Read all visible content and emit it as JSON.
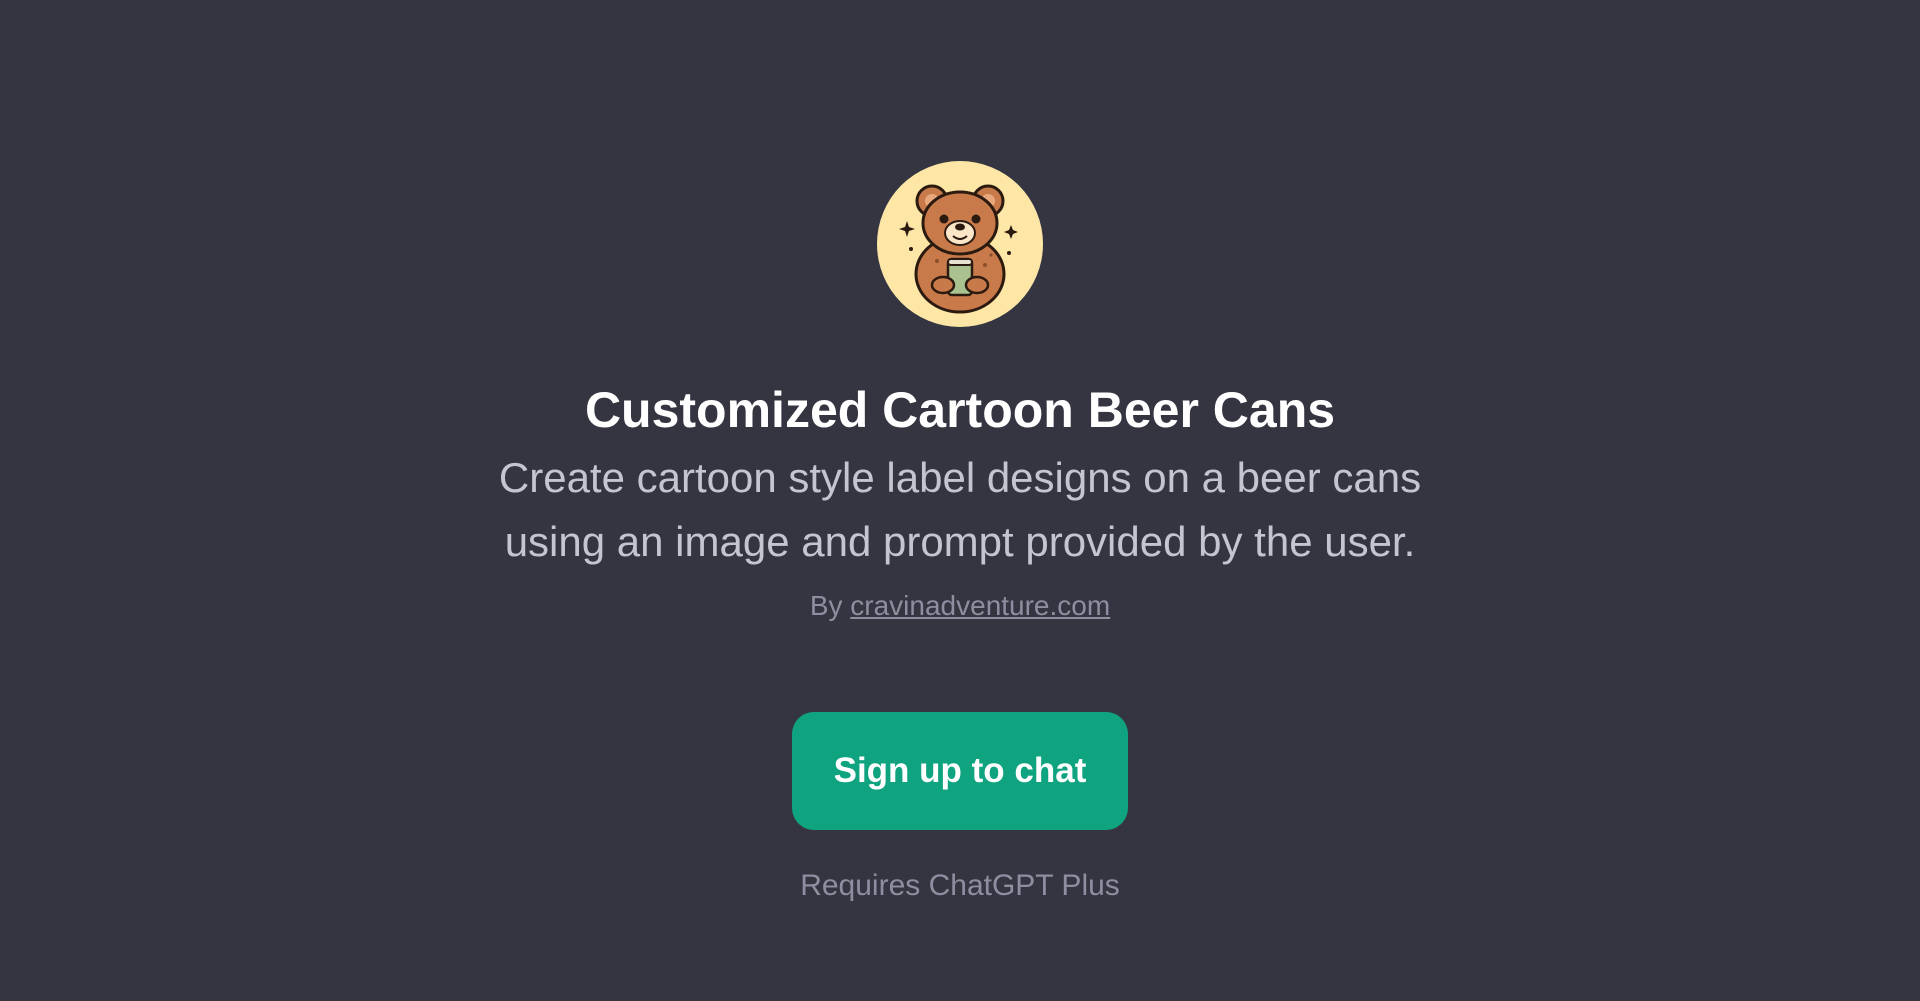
{
  "gpt": {
    "avatar_icon": "bear-with-beer-can-icon",
    "title": "Customized Cartoon Beer Cans",
    "description": "Create cartoon style label designs on a beer cans using an image and prompt provided by the user.",
    "byline_prefix": "By",
    "author": "cravinadventure.com"
  },
  "cta": {
    "label": "Sign up to chat"
  },
  "requirement": "Requires ChatGPT Plus",
  "colors": {
    "background": "#343541",
    "accent": "#10a37f",
    "avatar_background": "#fde6a6"
  }
}
